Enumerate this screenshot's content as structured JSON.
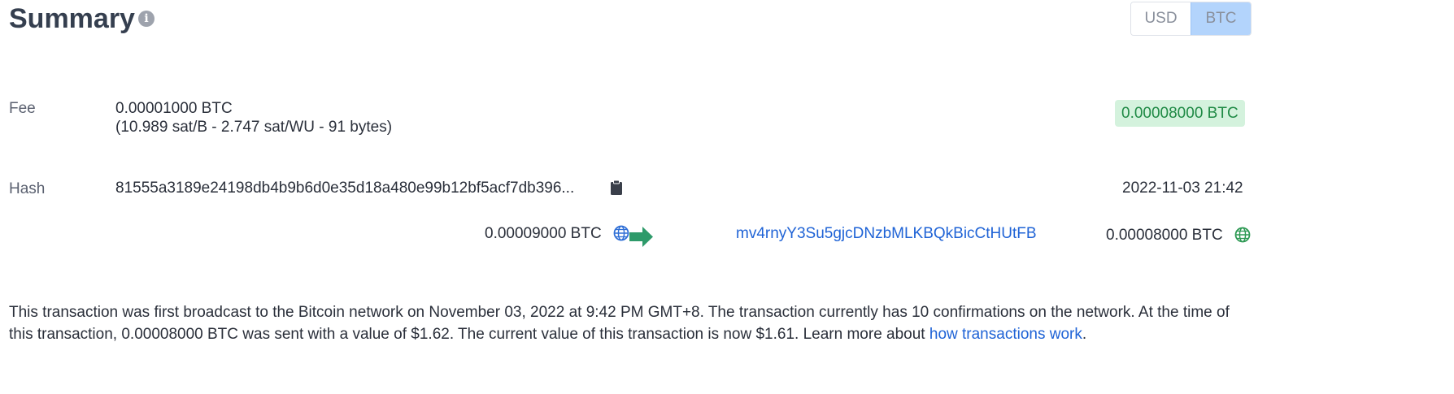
{
  "header": {
    "title": "Summary",
    "info_icon": "info-circle-icon",
    "currency_options": [
      {
        "label": "USD",
        "selected": false
      },
      {
        "label": "BTC",
        "selected": true
      }
    ]
  },
  "fee": {
    "label": "Fee",
    "amount": "0.00001000 BTC",
    "details": "(10.989 sat/B - 2.747 sat/WU - 91 bytes)"
  },
  "total_amount": "0.00008000 BTC",
  "hash": {
    "label": "Hash",
    "value": "81555a3189e24198db4b9b6d0e35d18a480e99b12bf5acf7db396...",
    "copy_icon": "clipboard-icon"
  },
  "timestamp": "2022-11-03 21:42",
  "flow": {
    "input_amount": "0.00009000 BTC",
    "input_icon": "globe-icon",
    "arrow_icon": "arrow-right-icon",
    "output_address": "mv4rnyY3Su5gjcDNzbMLKBQkBicCtHUtFB",
    "output_amount": "0.00008000 BTC",
    "output_icon": "globe-icon"
  },
  "description": {
    "text": "This transaction was first broadcast to the Bitcoin network on November 03, 2022 at 9:42 PM GMT+8.  The transaction currently has 10 confirmations on the network.  At the time of this transaction, 0.00008000 BTC was sent with a value of $1.62. The current value of this transaction is now $1.61.  Learn more about ",
    "link_text": "how transactions work",
    "suffix": "."
  },
  "colors": {
    "accent_blue": "#1f63d6",
    "success_green": "#1f8a45",
    "success_bg": "#d4f2dd",
    "toggle_selected_bg": "#b3d4fc",
    "arrow_green": "#2e9a6a",
    "globe_blue": "#2f6fd6",
    "globe_green": "#2f9a55"
  }
}
